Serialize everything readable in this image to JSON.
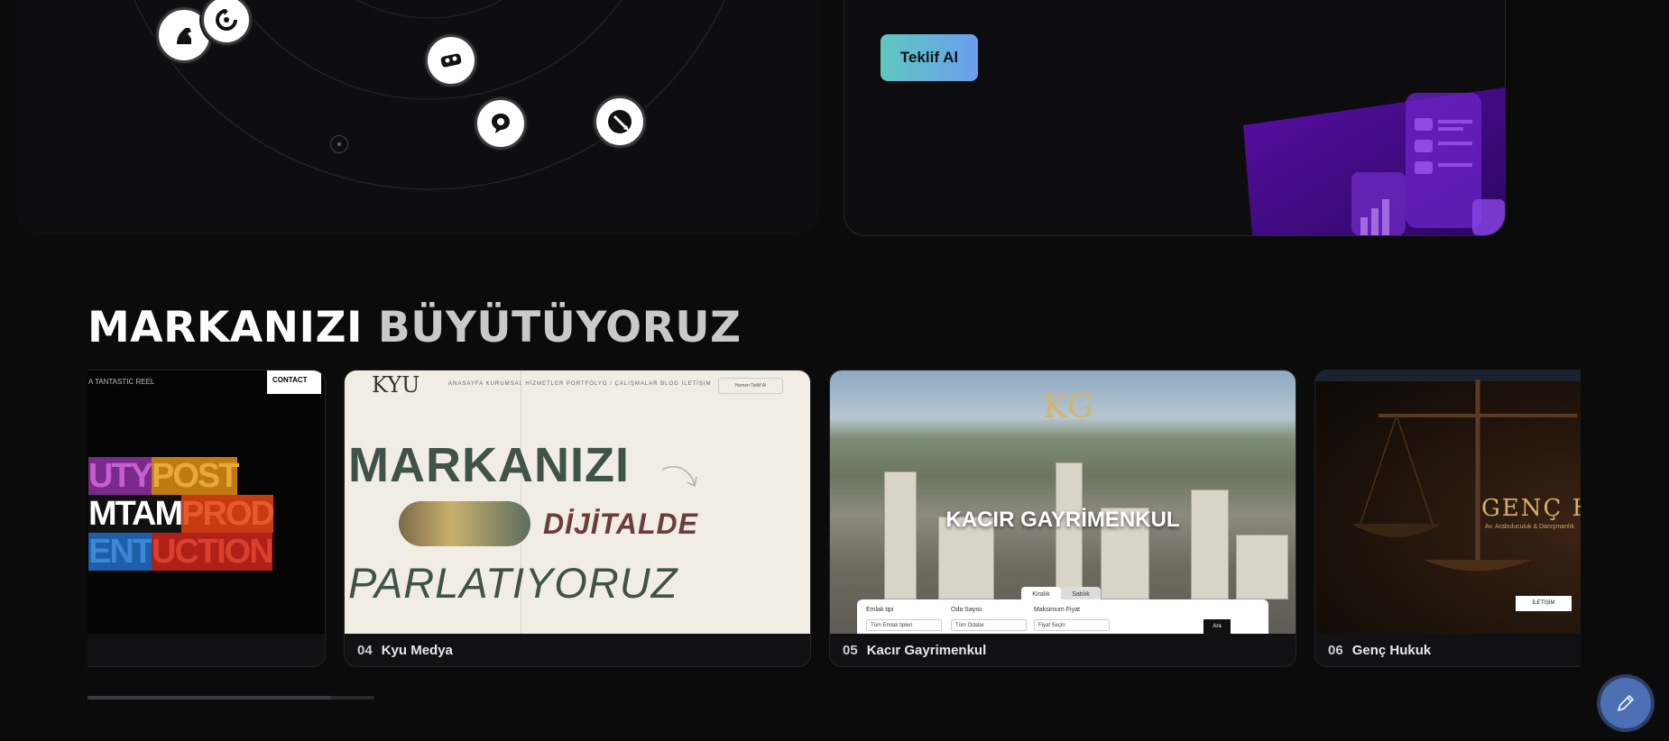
{
  "cta": {
    "button_label": "Teklif Al"
  },
  "heading": {
    "word1": "MARKANIZI",
    "word2": "BÜYÜTÜYORUZ"
  },
  "projects": [
    {
      "number": "",
      "name": "",
      "thumb": {
        "tag": "A TANTASTIC REEL",
        "contact": "CONTACT",
        "rows": [
          [
            "UTY",
            "POST"
          ],
          [
            "MTAM",
            "PROD"
          ],
          [
            "ENT",
            "UCTION"
          ]
        ]
      }
    },
    {
      "number": "04",
      "name": "Kyu Medya",
      "thumb": {
        "logo": "KYU",
        "nav": "ANASAYFA   KURUMSAL   HİZMETLER   PORTFOLYO / ÇALIŞMALAR   BLOG   İLETİŞİM",
        "nav_button": "Hemen Teklif Al",
        "line1": "MARKANIZI",
        "line2": "DİJİTALDE",
        "line3": "PARLATIYORUZ"
      }
    },
    {
      "number": "05",
      "name": "Kacır Gayrimenkul",
      "thumb": {
        "mark": "KG",
        "title": "KACIR GAYRİMENKUL",
        "tab_rent": "Kiralık",
        "tab_sale": "Satılık",
        "label1": "Emlak tipi",
        "select1": "Tüm Emlak tipleri",
        "label2": "Oda Sayısı",
        "select2": "Tüm Odalar",
        "label3": "Maksimum Fiyat",
        "select3": "Fiyat Seçin",
        "search": "Ara"
      }
    },
    {
      "number": "06",
      "name": "Genç Hukuk",
      "thumb": {
        "brand": "GENÇ HUKUK",
        "sub": "Av. Arabuluculuk & Danışmanlık",
        "button": "İLETİŞİM"
      }
    }
  ],
  "carousel_progress": 0.85,
  "colors": {
    "accent_gradient_start": "#5fc8c0",
    "accent_gradient_end": "#6a9ef0",
    "fab": "#4d6fb4"
  },
  "icons": [
    "chess-knight-icon",
    "refresh-icon",
    "vr-headset-icon",
    "chat-icon",
    "pen-icon",
    "edit-pencil-icon"
  ]
}
